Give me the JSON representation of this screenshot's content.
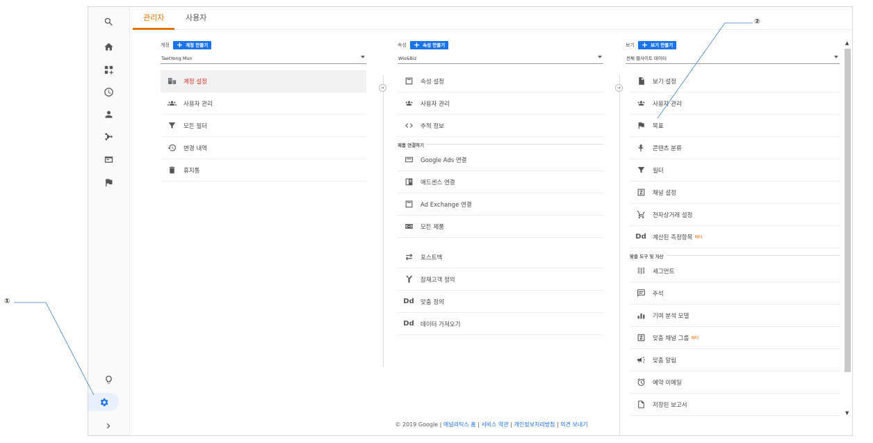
{
  "tabs": [
    {
      "label": "관리자",
      "active": true
    },
    {
      "label": "사용자",
      "active": false
    }
  ],
  "account": {
    "label": "계정",
    "create_label": "계정 만들기",
    "selected": "TaetYong Mun",
    "items": [
      {
        "label": "계정 설정",
        "icon": "building-icon",
        "selected": true
      },
      {
        "label": "사용자 관리",
        "icon": "people-icon"
      },
      {
        "label": "모든 필터",
        "icon": "filter-icon"
      },
      {
        "label": "변경 내역",
        "icon": "history-icon"
      },
      {
        "label": "휴지통",
        "icon": "trash-icon"
      }
    ]
  },
  "property": {
    "label": "속성",
    "create_label": "속성 만들기",
    "selected": "Wis&Biz",
    "items": [
      {
        "label": "속성 설정",
        "icon": "window-icon"
      },
      {
        "label": "사용자 관리",
        "icon": "people-icon"
      },
      {
        "label": "추적 정보",
        "icon": "code-icon"
      }
    ],
    "section": "제품 연결하기",
    "linking": [
      {
        "label": "Google Ads 연결",
        "icon": "ads-icon"
      },
      {
        "label": "애드센스 연결",
        "icon": "adsense-icon"
      },
      {
        "label": "Ad Exchange 연결",
        "icon": "window-icon"
      },
      {
        "label": "모든 제품",
        "icon": "link-icon"
      }
    ],
    "more": [
      {
        "label": "포스트백",
        "icon": "postback-icon"
      },
      {
        "label": "잠재고객 정의",
        "icon": "audience-icon"
      },
      {
        "label": "맞춤 정의",
        "icon": "dd-icon"
      },
      {
        "label": "데이터 가져오기",
        "icon": "dd-icon"
      }
    ]
  },
  "view": {
    "label": "보기",
    "create_label": "보기 만들기",
    "selected": "전체 웹사이트 데이터",
    "items": [
      {
        "label": "보기 설정",
        "icon": "file-icon"
      },
      {
        "label": "사용자 관리",
        "icon": "people-icon"
      },
      {
        "label": "목표",
        "icon": "flag-icon"
      },
      {
        "label": "콘텐츠 분류",
        "icon": "person-icon"
      },
      {
        "label": "필터",
        "icon": "filter-icon"
      },
      {
        "label": "채널 설정",
        "icon": "channel-icon"
      },
      {
        "label": "전자상거래 설정",
        "icon": "cart-icon"
      },
      {
        "label": "계산된 측정항목",
        "icon": "dd-icon",
        "badge": "베타"
      }
    ],
    "section": "맞춤 도구 및 자산",
    "tools": [
      {
        "label": "세그먼트",
        "icon": "segment-icon"
      },
      {
        "label": "주석",
        "icon": "comment-icon"
      },
      {
        "label": "기여 분석 모델",
        "icon": "bars-icon"
      },
      {
        "label": "맞춤 채널 그룹",
        "icon": "channel-icon",
        "badge": "베타"
      },
      {
        "label": "맞춤 알림",
        "icon": "megaphone-icon"
      },
      {
        "label": "예약 이메일",
        "icon": "clock-icon"
      },
      {
        "label": "저장된 보고서",
        "icon": "doc-icon"
      }
    ]
  },
  "footer": {
    "copyright": "© 2019 Google |",
    "links": [
      "애널리틱스 홈",
      "서비스 약관",
      "개인정보처리방침",
      "의견 보내기"
    ],
    "sep": "|"
  },
  "callouts": {
    "one": "①",
    "two": "②"
  },
  "dd_text": "Dd"
}
